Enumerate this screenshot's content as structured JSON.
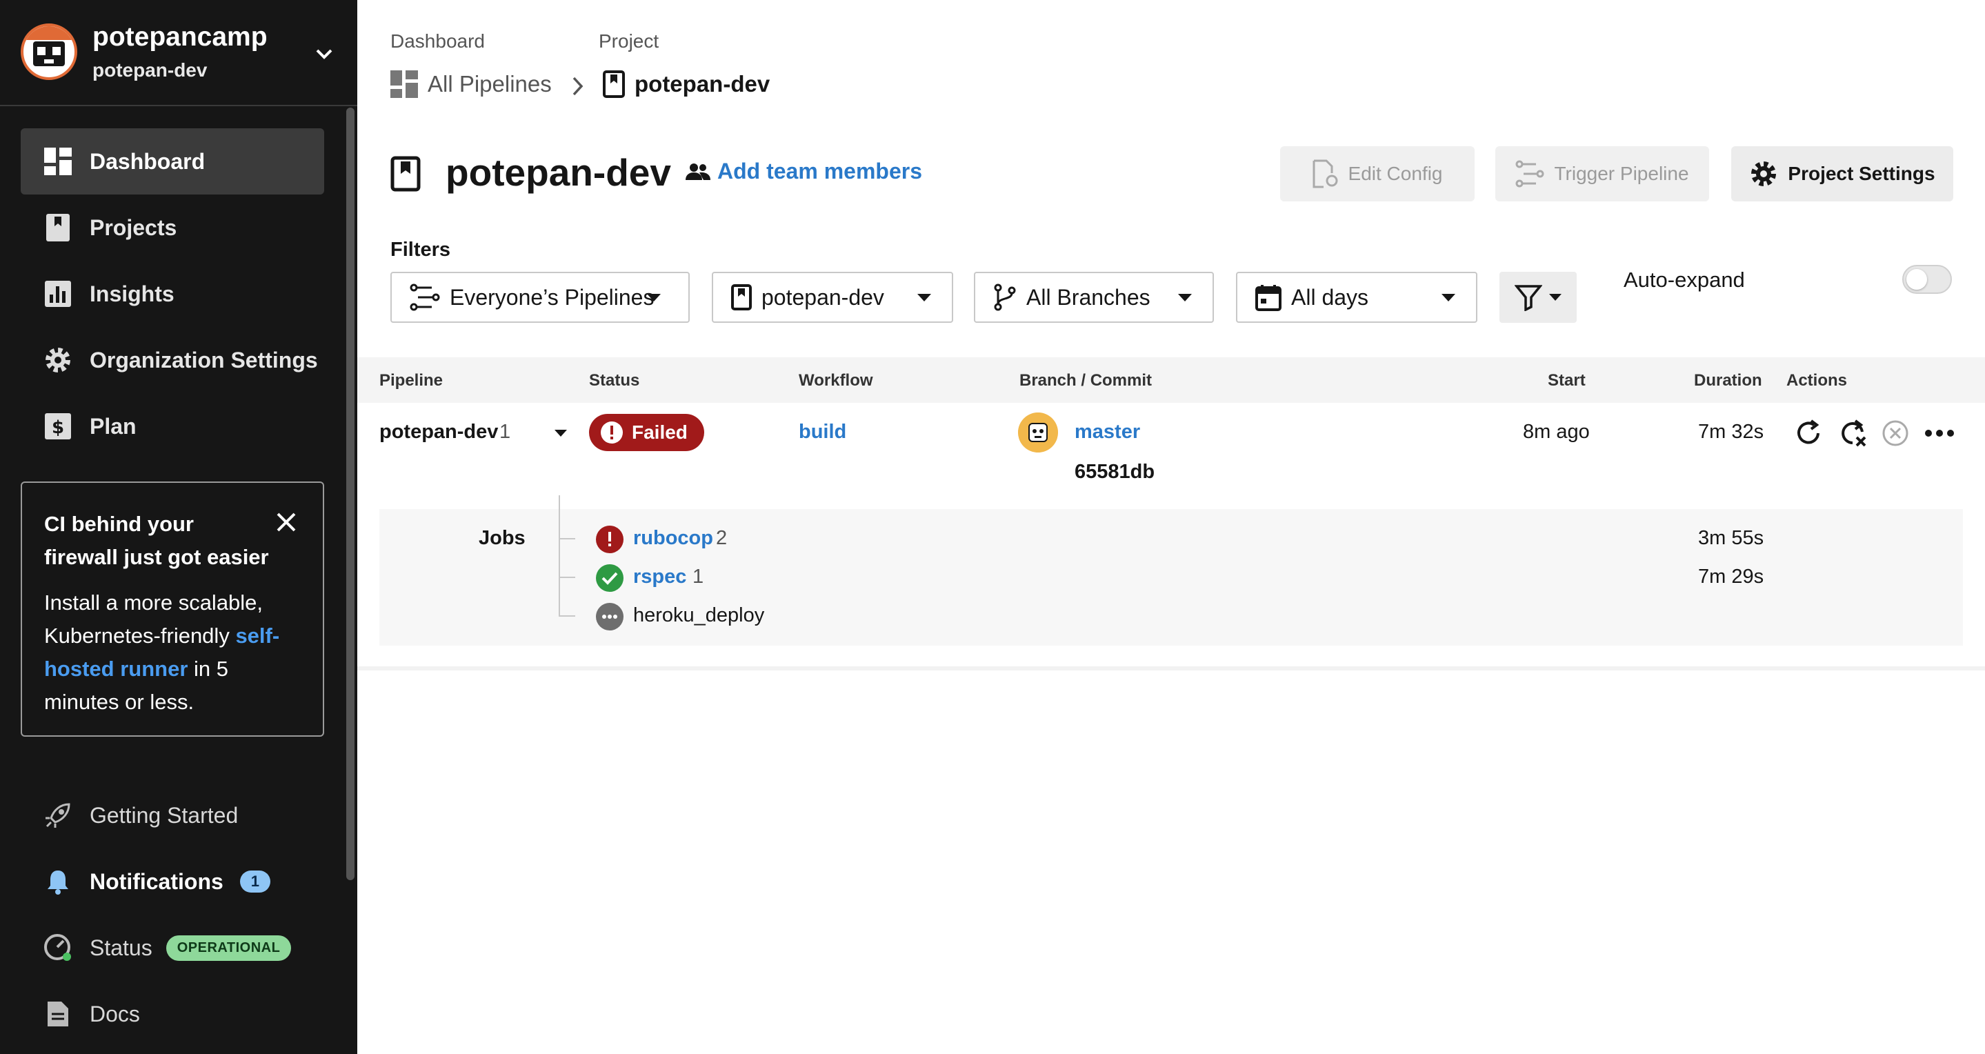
{
  "org": {
    "name": "potepancamp",
    "subtitle": "potepan-dev"
  },
  "sidebar": {
    "items": [
      {
        "label": "Dashboard",
        "icon": "dashboard-icon",
        "active": true
      },
      {
        "label": "Projects",
        "icon": "projects-icon"
      },
      {
        "label": "Insights",
        "icon": "insights-icon"
      },
      {
        "label": "Organization Settings",
        "icon": "gear-icon"
      },
      {
        "label": "Plan",
        "icon": "dollar-icon"
      }
    ],
    "promo": {
      "title": "CI behind your firewall just got easier",
      "body_pre": "Install a more scalable, Kubernetes-friendly ",
      "link": "self-hosted runner",
      "body_post": " in 5 minutes or less."
    },
    "bottom": {
      "getting_started": "Getting Started",
      "notifications": "Notifications",
      "notifications_count": "1",
      "status": "Status",
      "status_badge": "OPERATIONAL",
      "docs": "Docs"
    }
  },
  "breadcrumb": {
    "dashboard_label": "Dashboard",
    "all_pipelines": "All Pipelines",
    "project_label": "Project",
    "project": "potepan-dev"
  },
  "header": {
    "title": "potepan-dev",
    "add_team": "Add team members",
    "edit_config": "Edit Config",
    "trigger_pipeline": "Trigger Pipeline",
    "project_settings": "Project Settings"
  },
  "filters": {
    "label": "Filters",
    "pipelines": "Everyone’s Pipelines",
    "project": "potepan-dev",
    "branches": "All Branches",
    "days": "All days",
    "auto_expand": "Auto-expand"
  },
  "table": {
    "headers": {
      "pipeline": "Pipeline",
      "status": "Status",
      "workflow": "Workflow",
      "branch": "Branch / Commit",
      "start": "Start",
      "duration": "Duration",
      "actions": "Actions"
    },
    "row": {
      "pipeline": "potepan-dev",
      "number": "1",
      "status": "Failed",
      "workflow": "build",
      "branch": "master",
      "commit": "65581db",
      "start": "8m ago",
      "duration": "7m 32s"
    },
    "jobs_label": "Jobs",
    "jobs": [
      {
        "name": "rubocop",
        "count": "2",
        "duration": "3m 55s",
        "state": "failed"
      },
      {
        "name": "rspec",
        "count": "1",
        "duration": "7m 29s",
        "state": "success"
      },
      {
        "name": "heroku_deploy",
        "count": "",
        "duration": "",
        "state": "pending"
      }
    ]
  },
  "colors": {
    "sidebar_bg": "#161616",
    "link": "#2a79c9",
    "failed": "#a11a1a",
    "success": "#2e9a43"
  }
}
